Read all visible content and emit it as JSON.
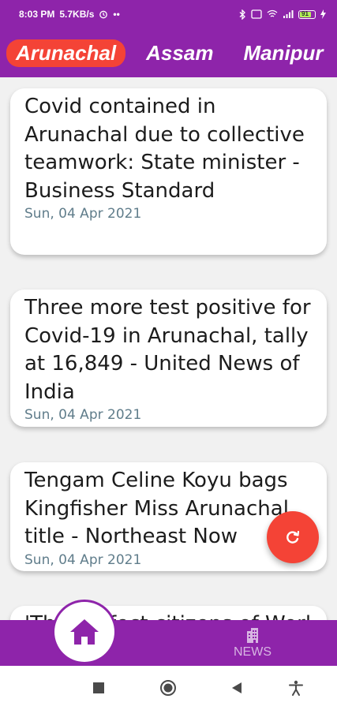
{
  "status_bar": {
    "time": "8:03 PM",
    "speed": "5.7KB/s",
    "battery_level": "91"
  },
  "tabs": [
    {
      "label": "Arunachal",
      "active": true
    },
    {
      "label": "Assam",
      "active": false
    },
    {
      "label": "Manipur",
      "active": false
    }
  ],
  "articles": [
    {
      "title": "Covid contained in Arunachal due to collective teamwork: State minister - Business Standard",
      "date": "Sun, 04 Apr 2021"
    },
    {
      "title": "Three more test positive for Covid-19 in Arunachal, tally at 16,849 - United News of India",
      "date": "Sun, 04 Apr 2021"
    },
    {
      "title": "Tengam Celine Koyu bags Kingfisher Miss Arunachal title - Northeast Now",
      "date": "Sun, 04 Apr 2021"
    },
    {
      "title": "'The perfect citizens of Worl",
      "date": ""
    }
  ],
  "bottom_nav": {
    "news_label": "NEWS"
  },
  "colors": {
    "primary": "#8e24aa",
    "accent": "#f44336",
    "date_text": "#607d8b"
  },
  "icons": {
    "fab": "refresh-icon",
    "home": "home-icon",
    "news": "building-icon"
  }
}
